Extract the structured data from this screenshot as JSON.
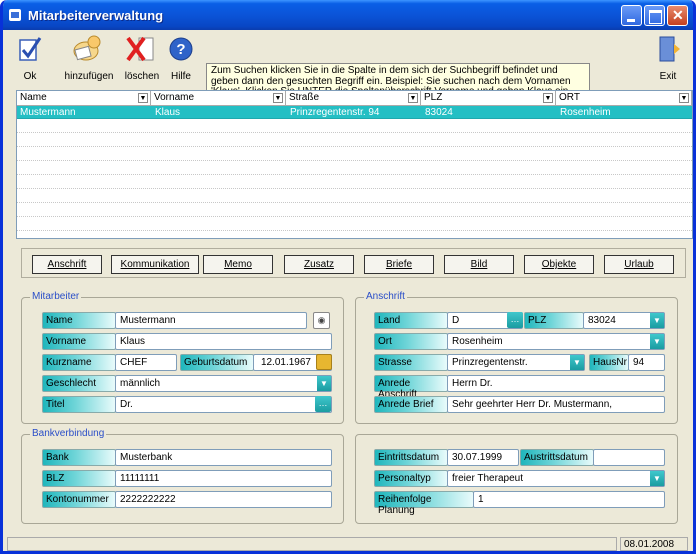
{
  "window": {
    "title": "Mitarbeiterverwaltung"
  },
  "toolbar": {
    "ok": "Ok",
    "add": "hinzufügen",
    "delete": "löschen",
    "help": "Hilfe",
    "exit": "Exit",
    "hint": "Zum Suchen klicken Sie in die Spalte in dem sich der Suchbegriff befindet und geben dann den gesuchten Begriff ein.  Beispiel: Sie suchen nach dem Vornamen 'Klaus'. Klicken Sie UNTER die Spaltenüberschrift Vorname und geben Klaus ein."
  },
  "grid": {
    "columns": [
      "Name",
      "Vorname",
      "Straße",
      "PLZ",
      "ORT"
    ],
    "rows": [
      [
        "Mustermann",
        "Klaus",
        "Prinzregentenstr. 94",
        "83024",
        "Rosenheim"
      ]
    ]
  },
  "tabs": [
    "Anschrift",
    "Kommunikation",
    "Memo",
    "Zusatz",
    "Briefe",
    "Bild",
    "Objekte",
    "Urlaub"
  ],
  "mitarbeiter": {
    "group": "Mitarbeiter",
    "name_label": "Name",
    "name": "Mustermann",
    "vorname_label": "Vorname",
    "vorname": "Klaus",
    "kurzname_label": "Kurzname",
    "kurzname": "CHEF",
    "geburtsdatum_label": "Geburtsdatum",
    "geburtsdatum": "12.01.1967",
    "geschlecht_label": "Geschlecht",
    "geschlecht": "männlich",
    "titel_label": "Titel",
    "titel": "Dr."
  },
  "anschrift": {
    "group": "Anschrift",
    "land_label": "Land",
    "land": "D",
    "plz_label": "PLZ",
    "plz": "83024",
    "ort_label": "Ort",
    "ort": "Rosenheim",
    "strasse_label": "Strasse",
    "strasse": "Prinzregentenstr.",
    "hausnr_label": "HausNr",
    "hausnr": "94",
    "anrede_anschrift_label": "Anrede Anschrift",
    "anrede_anschrift": "Herrn Dr.",
    "anrede_brief_label": "Anrede Brief",
    "anrede_brief": "Sehr geehrter Herr Dr.  Mustermann,"
  },
  "bank": {
    "group": "Bankverbindung",
    "bank_label": "Bank",
    "bank": "Musterbank",
    "blz_label": "BLZ",
    "blz": "11111111",
    "konto_label": "Kontonummer",
    "konto": "2222222222"
  },
  "vertrag": {
    "eintritt_label": "Eintrittsdatum",
    "eintritt": "30.07.1999",
    "austritt_label": "Austrittsdatum",
    "austritt": "",
    "personaltyp_label": "Personaltyp",
    "personaltyp": "freier Therapeut",
    "reihenfolge_label": "Reihenfolge Planung",
    "reihenfolge": "1"
  },
  "status": {
    "date": "08.01.2008"
  },
  "colors": {
    "accent": "#24bfc4",
    "titlebar": "#0b54d8"
  }
}
